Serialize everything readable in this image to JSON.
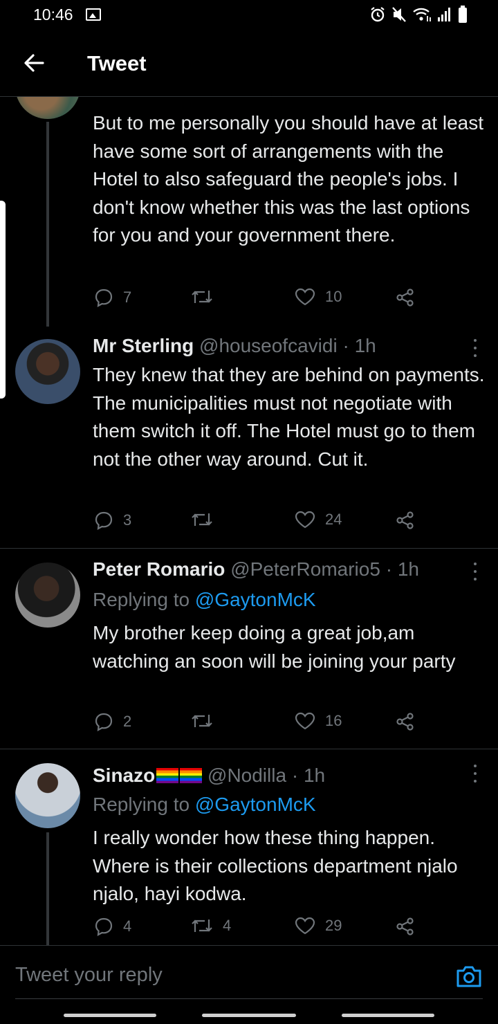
{
  "status_bar": {
    "time": "10:46"
  },
  "header": {
    "title": "Tweet"
  },
  "tweets": [
    {
      "text": "But to me personally you should have at least have some sort of arrangements with the Hotel to also safeguard the people's jobs. I don't know whether this was the last options for you and your government there.",
      "replies": "7",
      "retweets": "",
      "likes": "10"
    },
    {
      "name": "Mr Sterling",
      "handle": "@houseofcavidi",
      "time": "1h",
      "text": "They knew that they are behind on payments. The municipalities must not negotiate with them switch it off. The Hotel must go to them not the other way around. Cut it.",
      "replies": "3",
      "retweets": "",
      "likes": "24"
    },
    {
      "name": "Peter Romario",
      "handle": "@PeterRomario5",
      "time": "1h",
      "replying_prefix": "Replying to ",
      "replying_to": "@GaytonMcK",
      "text": "My brother keep doing a great job,am watching an soon will be joining your party",
      "replies": "2",
      "retweets": "",
      "likes": "16"
    },
    {
      "name": "Sinazo",
      "handle": "@Nodilla",
      "time": "1h",
      "replying_prefix": "Replying to ",
      "replying_to": "@GaytonMcK",
      "text": "I really wonder how these thing happen. Where is their collections department njalo njalo, hayi kodwa.",
      "replies": "4",
      "retweets": "4",
      "likes": "29"
    }
  ],
  "reply_box": {
    "placeholder": "Tweet your reply"
  },
  "colors": {
    "background": "#000000",
    "text": "#e7e9ea",
    "muted": "#71767b",
    "accent": "#1d9bf0",
    "divider": "#2f3336"
  }
}
